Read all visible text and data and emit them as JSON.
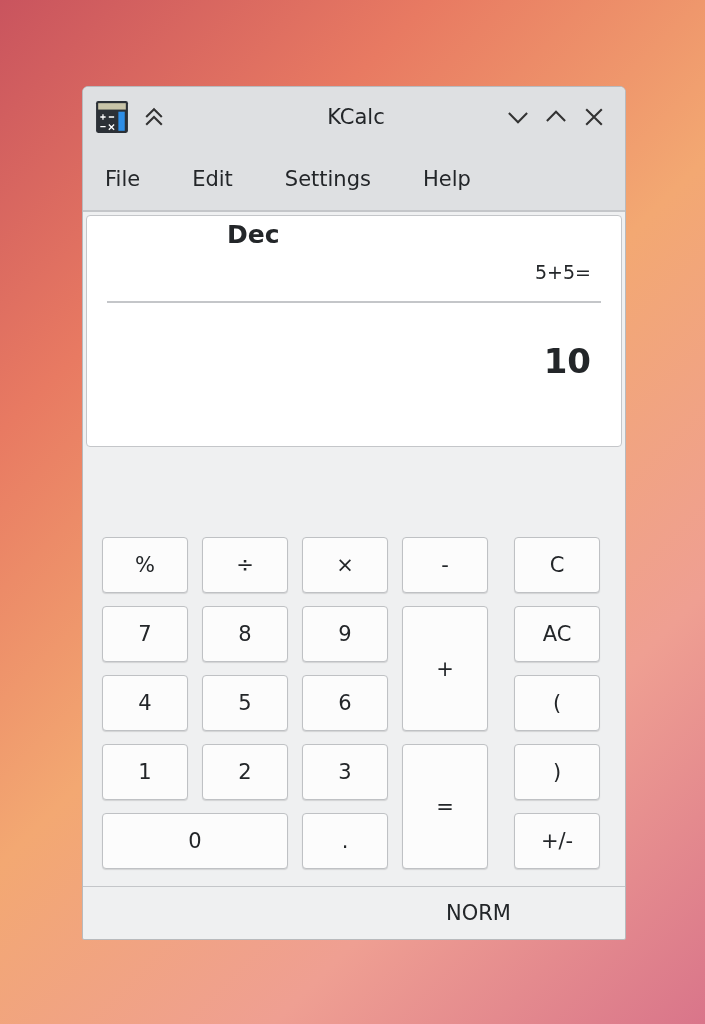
{
  "window": {
    "title": "KCalc"
  },
  "menu": [
    "File",
    "Edit",
    "Settings",
    "Help"
  ],
  "display": {
    "base": "Dec",
    "expression": "5+5=",
    "result": "10"
  },
  "keypad": [
    {
      "label": "%",
      "kind": "normal"
    },
    {
      "label": "÷",
      "kind": "normal"
    },
    {
      "label": "×",
      "kind": "normal"
    },
    {
      "label": "-",
      "kind": "normal"
    },
    {
      "label": "7",
      "kind": "normal"
    },
    {
      "label": "8",
      "kind": "normal"
    },
    {
      "label": "9",
      "kind": "normal"
    },
    {
      "label": "+",
      "kind": "tall"
    },
    {
      "label": "4",
      "kind": "normal"
    },
    {
      "label": "5",
      "kind": "normal"
    },
    {
      "label": "6",
      "kind": "normal"
    },
    {
      "label": "1",
      "kind": "normal"
    },
    {
      "label": "2",
      "kind": "normal"
    },
    {
      "label": "3",
      "kind": "normal"
    },
    {
      "label": "=",
      "kind": "tall"
    },
    {
      "label": "0",
      "kind": "wide"
    },
    {
      "label": ".",
      "kind": "normal"
    }
  ],
  "side_keys": [
    "C",
    "AC",
    "(",
    ")",
    "+/-"
  ],
  "status_bar": {
    "mode": "NORM"
  }
}
